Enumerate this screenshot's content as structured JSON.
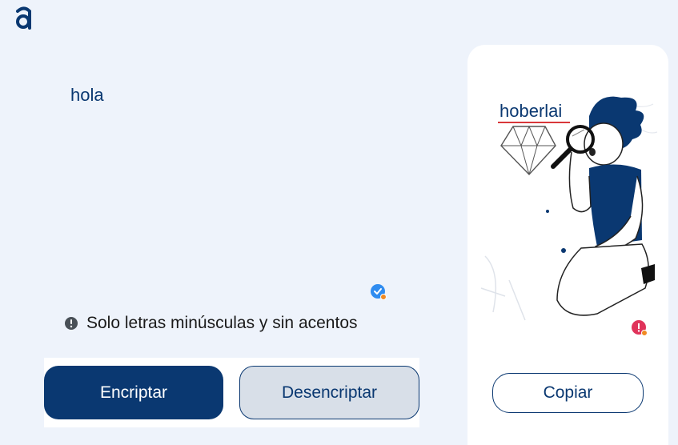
{
  "app": {
    "logo_icon": "alura-logo-icon"
  },
  "input": {
    "value": "hola"
  },
  "info": {
    "icon": "exclamation-circle-icon",
    "text": "Solo letras minúsculas y sin acentos"
  },
  "buttons": {
    "encrypt_label": "Encriptar",
    "decrypt_label": "Desencriptar",
    "copy_label": "Copiar"
  },
  "output": {
    "value": "hoberlai"
  },
  "colors": {
    "brand": "#0a3871",
    "background": "#eef3fb",
    "panel": "#ffffff",
    "secondary_button": "#d8dfe8",
    "spellcheck_underline": "#d9383a"
  }
}
